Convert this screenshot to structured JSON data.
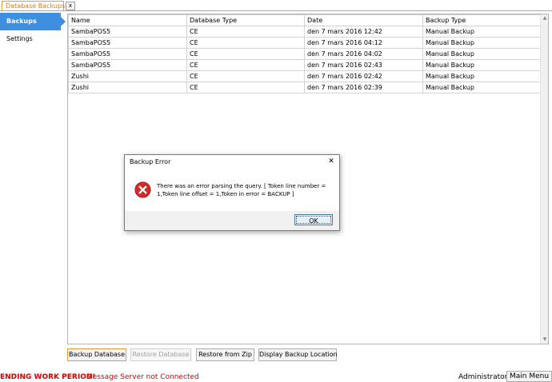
{
  "tabs": {
    "active_label": "Database Backups",
    "close_glyph": "x"
  },
  "sidebar": {
    "items": [
      {
        "label": "Backups",
        "active": true
      },
      {
        "label": "Settings",
        "active": false
      }
    ]
  },
  "table": {
    "columns": [
      "Name",
      "Database Type",
      "Date",
      "Backup Type"
    ],
    "rows": [
      [
        "SambaPOS5",
        "CE",
        "den 7 mars 2016 12:42",
        "Manual Backup"
      ],
      [
        "SambaPOS5",
        "CE",
        "den 7 mars 2016 04:12",
        "Manual Backup"
      ],
      [
        "SambaPOS5",
        "CE",
        "den 7 mars 2016 04:02",
        "Manual Backup"
      ],
      [
        "SambaPOS5",
        "CE",
        "den 7 mars 2016 02:43",
        "Manual Backup"
      ],
      [
        "Zushi",
        "CE",
        "den 7 mars 2016 02:42",
        "Manual Backup"
      ],
      [
        "Zushi",
        "CE",
        "den 7 mars 2016 02:39",
        "Manual Backup"
      ]
    ]
  },
  "buttons": {
    "backup_database": "Backup Database",
    "restore_database": "Restore Database",
    "restore_from_zip": "Restore from Zip",
    "display_backup_location": "Display Backup Location"
  },
  "status": {
    "warning": "ENDING WORK PERIOD!",
    "message": "Message Server not Connected",
    "user": "Administrator",
    "main_menu": "Main Menu"
  },
  "dialog": {
    "title": "Backup Error",
    "close_glyph": "✕",
    "message": "There was an error parsing the query. [ Token line number = 1,Token line offset = 1,Token in error = BACKUP ]",
    "ok_label": "OK",
    "icon": "error-icon"
  },
  "colors": {
    "accent_orange": "#e89b3c",
    "nav_active": "#3f8fe0",
    "status_red": "#d40000",
    "error_red": "#d42a2a"
  }
}
